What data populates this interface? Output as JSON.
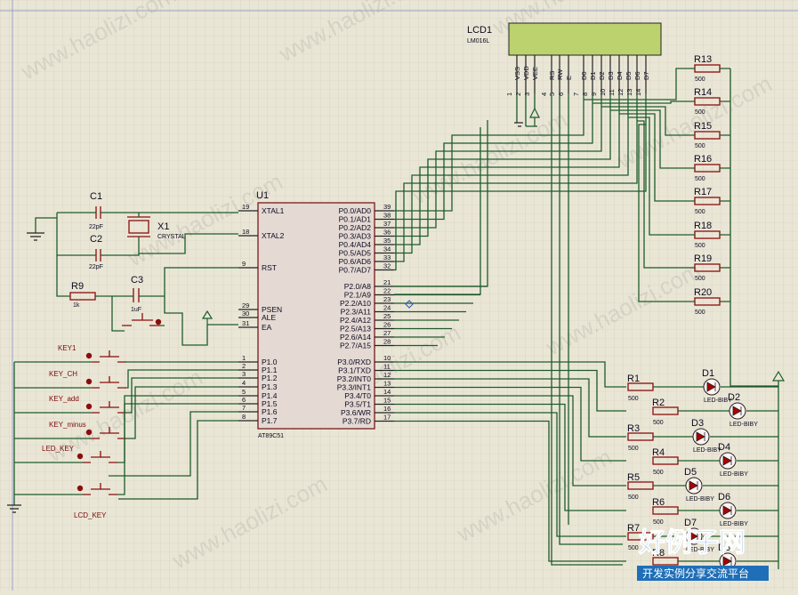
{
  "lcd": {
    "ref": "LCD1",
    "model": "LM016L",
    "pins": [
      {
        "name": "VSS",
        "num": "1"
      },
      {
        "name": "VDD",
        "num": "2"
      },
      {
        "name": "VEE",
        "num": "3"
      },
      {
        "name": "RS",
        "num": "4"
      },
      {
        "name": "RW",
        "num": "5"
      },
      {
        "name": "E",
        "num": "6"
      },
      {
        "name": "D0",
        "num": "7"
      },
      {
        "name": "D1",
        "num": "8"
      },
      {
        "name": "D2",
        "num": "9"
      },
      {
        "name": "D3",
        "num": "10"
      },
      {
        "name": "D4",
        "num": "11"
      },
      {
        "name": "D5",
        "num": "12"
      },
      {
        "name": "D6",
        "num": "13"
      },
      {
        "name": "D7",
        "num": "14"
      }
    ],
    "color": "#bcd26e"
  },
  "mcu": {
    "ref": "U1",
    "model": "AT89C51",
    "left_pins": [
      {
        "num": "19",
        "name": "XTAL1"
      },
      {
        "num": "18",
        "name": "XTAL2"
      },
      {
        "num": "9",
        "name": "RST"
      },
      {
        "num": "29",
        "name": "PSEN"
      },
      {
        "num": "30",
        "name": "ALE"
      },
      {
        "num": "31",
        "name": "EA"
      },
      {
        "num": "1",
        "name": "P1.0"
      },
      {
        "num": "2",
        "name": "P1.1"
      },
      {
        "num": "3",
        "name": "P1.2"
      },
      {
        "num": "4",
        "name": "P1.3"
      },
      {
        "num": "5",
        "name": "P1.4"
      },
      {
        "num": "6",
        "name": "P1.5"
      },
      {
        "num": "7",
        "name": "P1.6"
      },
      {
        "num": "8",
        "name": "P1.7"
      }
    ],
    "right_pins": [
      {
        "num": "39",
        "name": "P0.0/AD0"
      },
      {
        "num": "38",
        "name": "P0.1/AD1"
      },
      {
        "num": "37",
        "name": "P0.2/AD2"
      },
      {
        "num": "36",
        "name": "P0.3/AD3"
      },
      {
        "num": "35",
        "name": "P0.4/AD4"
      },
      {
        "num": "34",
        "name": "P0.5/AD5"
      },
      {
        "num": "33",
        "name": "P0.6/AD6"
      },
      {
        "num": "32",
        "name": "P0.7/AD7"
      },
      {
        "num": "21",
        "name": "P2.0/A8"
      },
      {
        "num": "22",
        "name": "P2.1/A9"
      },
      {
        "num": "23",
        "name": "P2.2/A10"
      },
      {
        "num": "24",
        "name": "P2.3/A11"
      },
      {
        "num": "25",
        "name": "P2.4/A12"
      },
      {
        "num": "26",
        "name": "P2.5/A13"
      },
      {
        "num": "27",
        "name": "P2.6/A14"
      },
      {
        "num": "28",
        "name": "P2.7/A15"
      },
      {
        "num": "10",
        "name": "P3.0/RXD"
      },
      {
        "num": "11",
        "name": "P3.1/TXD"
      },
      {
        "num": "12",
        "name": "P3.2/INT0"
      },
      {
        "num": "13",
        "name": "P3.3/INT1"
      },
      {
        "num": "14",
        "name": "P3.4/T0"
      },
      {
        "num": "15",
        "name": "P3.5/T1"
      },
      {
        "num": "16",
        "name": "P3.6/WR"
      },
      {
        "num": "17",
        "name": "P3.7/RD"
      }
    ]
  },
  "caps": [
    {
      "ref": "C1",
      "value": "22pF"
    },
    {
      "ref": "C2",
      "value": "22pF"
    },
    {
      "ref": "C3",
      "value": "1uF"
    }
  ],
  "crystal": {
    "ref": "X1",
    "value": "CRYSTAL"
  },
  "r9": {
    "ref": "R9",
    "value": "1k"
  },
  "pullups": [
    {
      "ref": "R13",
      "value": "500"
    },
    {
      "ref": "R14",
      "value": "500"
    },
    {
      "ref": "R15",
      "value": "500"
    },
    {
      "ref": "R16",
      "value": "500"
    },
    {
      "ref": "R17",
      "value": "500"
    },
    {
      "ref": "R18",
      "value": "500"
    },
    {
      "ref": "R19",
      "value": "500"
    },
    {
      "ref": "R20",
      "value": "500"
    }
  ],
  "led_resistors": [
    {
      "ref": "R1",
      "value": "500"
    },
    {
      "ref": "R2",
      "value": "500"
    },
    {
      "ref": "R3",
      "value": "500"
    },
    {
      "ref": "R4",
      "value": "500"
    },
    {
      "ref": "R5",
      "value": "500"
    },
    {
      "ref": "R6",
      "value": "500"
    },
    {
      "ref": "R7",
      "value": "500"
    },
    {
      "ref": "R8",
      "value": ""
    }
  ],
  "leds": [
    {
      "ref": "D1",
      "value": "LED-BIBY"
    },
    {
      "ref": "D2",
      "value": "LED-BIBY"
    },
    {
      "ref": "D3",
      "value": "LED-BIBY"
    },
    {
      "ref": "D4",
      "value": "LED-BIBY"
    },
    {
      "ref": "D5",
      "value": "LED-BIBY"
    },
    {
      "ref": "D6",
      "value": "LED-BIBY"
    },
    {
      "ref": "D7",
      "value": "LED-BIBY"
    },
    {
      "ref": "D8",
      "value": ""
    }
  ],
  "keys": [
    "KEY1",
    "KEY_CH",
    "KEY_add",
    "KEY_minus",
    "LED_KEY",
    "LCD_KEY"
  ],
  "watermark": {
    "text": "www.haolizi.com",
    "logo": "好例子网",
    "tagline": "开发实例分享交流平台"
  },
  "colors": {
    "wire": "#1d5c2a",
    "part": "#8a0d0d",
    "background": "#eae6d6",
    "logo": "#2a7fd0"
  }
}
